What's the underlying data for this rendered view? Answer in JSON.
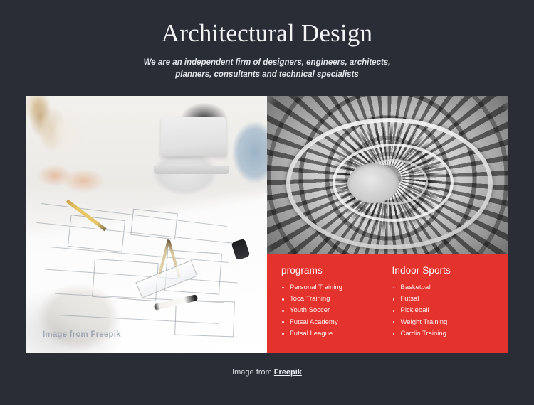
{
  "theme": {
    "background": "#2a2d36",
    "accent_red": "#e4322c",
    "text_light": "#f2f2f4"
  },
  "header": {
    "title": "Architectural Design",
    "subtitle": "We are an independent firm of designers, engineers, architects, planners, consultants and technical specialists"
  },
  "media": {
    "left_photo_alt": "Architects reviewing blueprints on a desk with laptop, hard hat, pencil and compass",
    "right_photo_alt": "Black and white spiral staircase viewed from above",
    "watermark": "Image from Freepik"
  },
  "programs_panel": {
    "columns": [
      {
        "heading": "programs",
        "items": [
          "Personal Training",
          "Toca Training",
          "Youth Soccer",
          "Futsal Academy",
          "Futsal League"
        ]
      },
      {
        "heading": "Indoor Sports",
        "items": [
          "Basketball",
          "Futsal",
          "Pickleball",
          "Weight Training",
          "Cardio Training"
        ]
      }
    ]
  },
  "footer": {
    "prefix": "Image from ",
    "link": "Freepik"
  }
}
